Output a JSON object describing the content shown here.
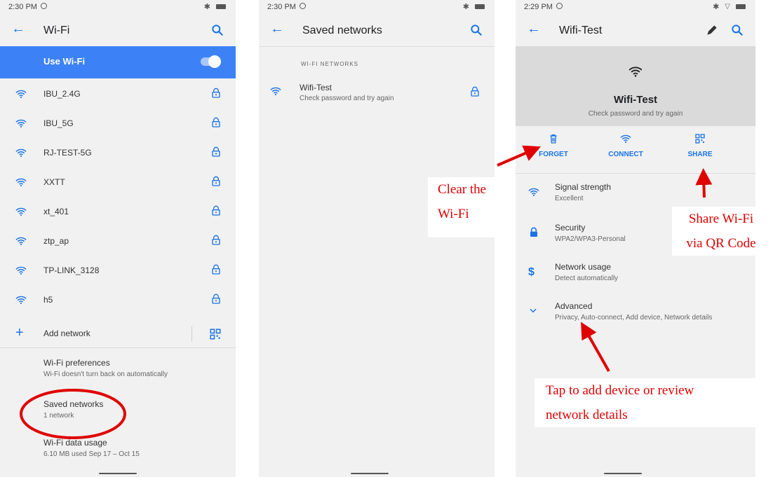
{
  "screen1": {
    "status_time": "2:30 PM",
    "title": "Wi-Fi",
    "use_wifi_label": "Use Wi-Fi",
    "networks": [
      {
        "name": "IBU_2.4G"
      },
      {
        "name": "IBU_5G"
      },
      {
        "name": "RJ-TEST-5G"
      },
      {
        "name": "XXTT"
      },
      {
        "name": "xt_401"
      },
      {
        "name": "ztp_ap"
      },
      {
        "name": "TP-LINK_3128"
      },
      {
        "name": "h5"
      }
    ],
    "add_network_label": "Add network",
    "preferences_title": "Wi-Fi preferences",
    "preferences_subtitle": "Wi-Fi doesn't turn back on automatically",
    "saved_title": "Saved networks",
    "saved_subtitle": "1 network",
    "usage_title": "Wi-Fi data usage",
    "usage_subtitle": "6.10 MB used Sep 17 – Oct 15"
  },
  "screen2": {
    "status_time": "2:30 PM",
    "title": "Saved networks",
    "section_header": "WI-FI NETWORKS",
    "network_name": "Wifi-Test",
    "network_status": "Check password and try again"
  },
  "screen3": {
    "status_time": "2:29 PM",
    "title": "Wifi-Test",
    "hero_name": "Wifi-Test",
    "hero_status": "Check password and try again",
    "actions": {
      "forget": "FORGET",
      "connect": "CONNECT",
      "share": "SHARE"
    },
    "details": [
      {
        "title": "Signal strength",
        "value": "Excellent",
        "icon": "wifi-icon"
      },
      {
        "title": "Security",
        "value": "WPA2/WPA3-Personal",
        "icon": "lock-icon"
      },
      {
        "title": "Network usage",
        "value": "Detect automatically",
        "icon": "dollar-icon"
      },
      {
        "title": "Advanced",
        "value": "Privacy, Auto-connect, Add device, Network details",
        "icon": "chevron-down-icon"
      }
    ]
  },
  "annotations": {
    "clear_line1": "Clear the",
    "clear_line2": "Wi-Fi",
    "share_line1": "Share Wi-Fi",
    "share_line2": "via QR Code",
    "tap_line1": "Tap to add device or review",
    "tap_line2": "network details"
  },
  "colors": {
    "accent": "#1a73e8",
    "toggle_bar": "#3c82f6",
    "annotation": "#e00000"
  }
}
